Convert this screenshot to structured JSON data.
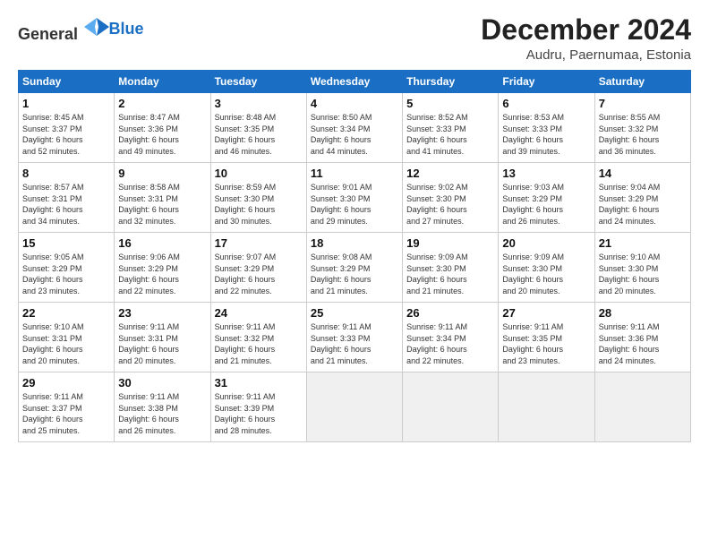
{
  "header": {
    "logo_general": "General",
    "logo_blue": "Blue",
    "month": "December 2024",
    "location": "Audru, Paernumaa, Estonia"
  },
  "weekdays": [
    "Sunday",
    "Monday",
    "Tuesday",
    "Wednesday",
    "Thursday",
    "Friday",
    "Saturday"
  ],
  "weeks": [
    [
      {
        "day": "1",
        "lines": [
          "Sunrise: 8:45 AM",
          "Sunset: 3:37 PM",
          "Daylight: 6 hours",
          "and 52 minutes."
        ]
      },
      {
        "day": "2",
        "lines": [
          "Sunrise: 8:47 AM",
          "Sunset: 3:36 PM",
          "Daylight: 6 hours",
          "and 49 minutes."
        ]
      },
      {
        "day": "3",
        "lines": [
          "Sunrise: 8:48 AM",
          "Sunset: 3:35 PM",
          "Daylight: 6 hours",
          "and 46 minutes."
        ]
      },
      {
        "day": "4",
        "lines": [
          "Sunrise: 8:50 AM",
          "Sunset: 3:34 PM",
          "Daylight: 6 hours",
          "and 44 minutes."
        ]
      },
      {
        "day": "5",
        "lines": [
          "Sunrise: 8:52 AM",
          "Sunset: 3:33 PM",
          "Daylight: 6 hours",
          "and 41 minutes."
        ]
      },
      {
        "day": "6",
        "lines": [
          "Sunrise: 8:53 AM",
          "Sunset: 3:33 PM",
          "Daylight: 6 hours",
          "and 39 minutes."
        ]
      },
      {
        "day": "7",
        "lines": [
          "Sunrise: 8:55 AM",
          "Sunset: 3:32 PM",
          "Daylight: 6 hours",
          "and 36 minutes."
        ]
      }
    ],
    [
      {
        "day": "8",
        "lines": [
          "Sunrise: 8:57 AM",
          "Sunset: 3:31 PM",
          "Daylight: 6 hours",
          "and 34 minutes."
        ]
      },
      {
        "day": "9",
        "lines": [
          "Sunrise: 8:58 AM",
          "Sunset: 3:31 PM",
          "Daylight: 6 hours",
          "and 32 minutes."
        ]
      },
      {
        "day": "10",
        "lines": [
          "Sunrise: 8:59 AM",
          "Sunset: 3:30 PM",
          "Daylight: 6 hours",
          "and 30 minutes."
        ]
      },
      {
        "day": "11",
        "lines": [
          "Sunrise: 9:01 AM",
          "Sunset: 3:30 PM",
          "Daylight: 6 hours",
          "and 29 minutes."
        ]
      },
      {
        "day": "12",
        "lines": [
          "Sunrise: 9:02 AM",
          "Sunset: 3:30 PM",
          "Daylight: 6 hours",
          "and 27 minutes."
        ]
      },
      {
        "day": "13",
        "lines": [
          "Sunrise: 9:03 AM",
          "Sunset: 3:29 PM",
          "Daylight: 6 hours",
          "and 26 minutes."
        ]
      },
      {
        "day": "14",
        "lines": [
          "Sunrise: 9:04 AM",
          "Sunset: 3:29 PM",
          "Daylight: 6 hours",
          "and 24 minutes."
        ]
      }
    ],
    [
      {
        "day": "15",
        "lines": [
          "Sunrise: 9:05 AM",
          "Sunset: 3:29 PM",
          "Daylight: 6 hours",
          "and 23 minutes."
        ]
      },
      {
        "day": "16",
        "lines": [
          "Sunrise: 9:06 AM",
          "Sunset: 3:29 PM",
          "Daylight: 6 hours",
          "and 22 minutes."
        ]
      },
      {
        "day": "17",
        "lines": [
          "Sunrise: 9:07 AM",
          "Sunset: 3:29 PM",
          "Daylight: 6 hours",
          "and 22 minutes."
        ]
      },
      {
        "day": "18",
        "lines": [
          "Sunrise: 9:08 AM",
          "Sunset: 3:29 PM",
          "Daylight: 6 hours",
          "and 21 minutes."
        ]
      },
      {
        "day": "19",
        "lines": [
          "Sunrise: 9:09 AM",
          "Sunset: 3:30 PM",
          "Daylight: 6 hours",
          "and 21 minutes."
        ]
      },
      {
        "day": "20",
        "lines": [
          "Sunrise: 9:09 AM",
          "Sunset: 3:30 PM",
          "Daylight: 6 hours",
          "and 20 minutes."
        ]
      },
      {
        "day": "21",
        "lines": [
          "Sunrise: 9:10 AM",
          "Sunset: 3:30 PM",
          "Daylight: 6 hours",
          "and 20 minutes."
        ]
      }
    ],
    [
      {
        "day": "22",
        "lines": [
          "Sunrise: 9:10 AM",
          "Sunset: 3:31 PM",
          "Daylight: 6 hours",
          "and 20 minutes."
        ]
      },
      {
        "day": "23",
        "lines": [
          "Sunrise: 9:11 AM",
          "Sunset: 3:31 PM",
          "Daylight: 6 hours",
          "and 20 minutes."
        ]
      },
      {
        "day": "24",
        "lines": [
          "Sunrise: 9:11 AM",
          "Sunset: 3:32 PM",
          "Daylight: 6 hours",
          "and 21 minutes."
        ]
      },
      {
        "day": "25",
        "lines": [
          "Sunrise: 9:11 AM",
          "Sunset: 3:33 PM",
          "Daylight: 6 hours",
          "and 21 minutes."
        ]
      },
      {
        "day": "26",
        "lines": [
          "Sunrise: 9:11 AM",
          "Sunset: 3:34 PM",
          "Daylight: 6 hours",
          "and 22 minutes."
        ]
      },
      {
        "day": "27",
        "lines": [
          "Sunrise: 9:11 AM",
          "Sunset: 3:35 PM",
          "Daylight: 6 hours",
          "and 23 minutes."
        ]
      },
      {
        "day": "28",
        "lines": [
          "Sunrise: 9:11 AM",
          "Sunset: 3:36 PM",
          "Daylight: 6 hours",
          "and 24 minutes."
        ]
      }
    ],
    [
      {
        "day": "29",
        "lines": [
          "Sunrise: 9:11 AM",
          "Sunset: 3:37 PM",
          "Daylight: 6 hours",
          "and 25 minutes."
        ]
      },
      {
        "day": "30",
        "lines": [
          "Sunrise: 9:11 AM",
          "Sunset: 3:38 PM",
          "Daylight: 6 hours",
          "and 26 minutes."
        ]
      },
      {
        "day": "31",
        "lines": [
          "Sunrise: 9:11 AM",
          "Sunset: 3:39 PM",
          "Daylight: 6 hours",
          "and 28 minutes."
        ]
      },
      null,
      null,
      null,
      null
    ]
  ]
}
